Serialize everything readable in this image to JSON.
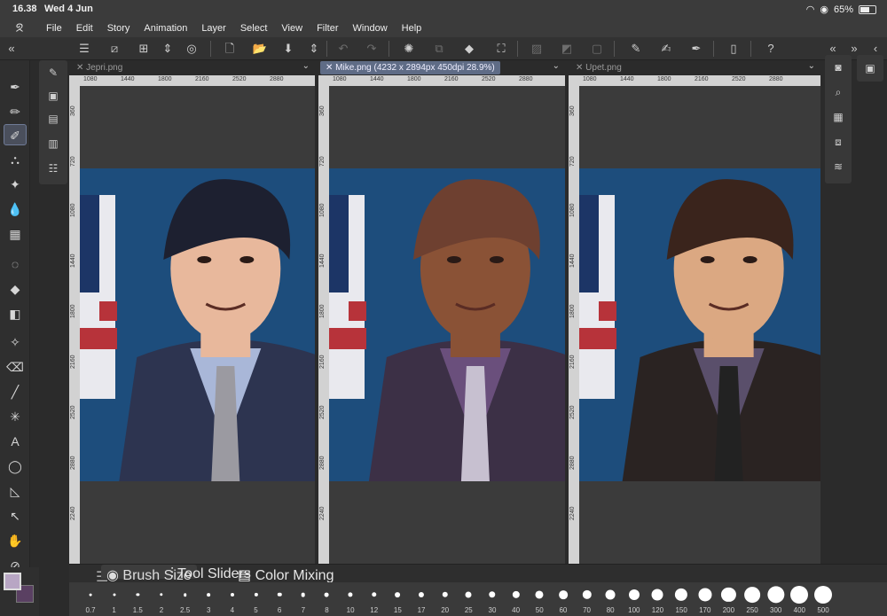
{
  "status": {
    "time": "16.38",
    "date": "Wed 4 Jun",
    "battery": "65%",
    "battery_level": 0.65
  },
  "menu": [
    "File",
    "Edit",
    "Story",
    "Animation",
    "Layer",
    "Select",
    "View",
    "Filter",
    "Window",
    "Help"
  ],
  "canvases": [
    {
      "tab": "Jepri.png",
      "active": false,
      "ruler_top": [
        "1080",
        "1440",
        "1800",
        "2160",
        "2520",
        "2880"
      ],
      "ruler_left": [
        "360",
        "720",
        "1080",
        "1440",
        "1800",
        "2160",
        "2520",
        "2880",
        "2240"
      ],
      "suit": "#2d3450",
      "shirt": "#a9b7d8",
      "tie": "#9b9aa1",
      "hair": "#1d2030",
      "skin": "#e8b89c"
    },
    {
      "tab": "Mike.png (4232 x 2894px 450dpi 28.9%)",
      "active": true,
      "ruler_top": [
        "1080",
        "1440",
        "1800",
        "2160",
        "2520",
        "2880"
      ],
      "ruler_left": [
        "360",
        "720",
        "1080",
        "1440",
        "1800",
        "2160",
        "2520",
        "2880",
        "2240"
      ],
      "suit": "#3c3046",
      "shirt": "#6a4f7c",
      "tie": "#c7c0d0",
      "hair": "#6e4030",
      "skin": "#8a5236"
    },
    {
      "tab": "Upet.png",
      "active": false,
      "ruler_top": [
        "1080",
        "1440",
        "1800",
        "2160",
        "2520",
        "2880"
      ],
      "ruler_left": [
        "360",
        "720",
        "1080",
        "1440",
        "1800",
        "2160",
        "2520",
        "2880",
        "2240"
      ],
      "suit": "#2a2322",
      "shirt": "#5a4f6b",
      "tie": "#222",
      "hair": "#3a241c",
      "skin": "#dba882"
    }
  ],
  "bottom_panel": {
    "tabs": [
      "Brush Size",
      "Tool Sliders",
      "Color Mixing"
    ],
    "sizes": [
      "0.7",
      "1",
      "1.5",
      "2",
      "2.5",
      "3",
      "4",
      "5",
      "6",
      "7",
      "8",
      "10",
      "12",
      "15",
      "17",
      "20",
      "25",
      "30",
      "40",
      "50",
      "60",
      "70",
      "80",
      "100",
      "120",
      "150",
      "170",
      "200",
      "250",
      "300",
      "400",
      "500"
    ]
  },
  "colors": {
    "main": "#b8a6c4",
    "sub": "#5a4062"
  }
}
